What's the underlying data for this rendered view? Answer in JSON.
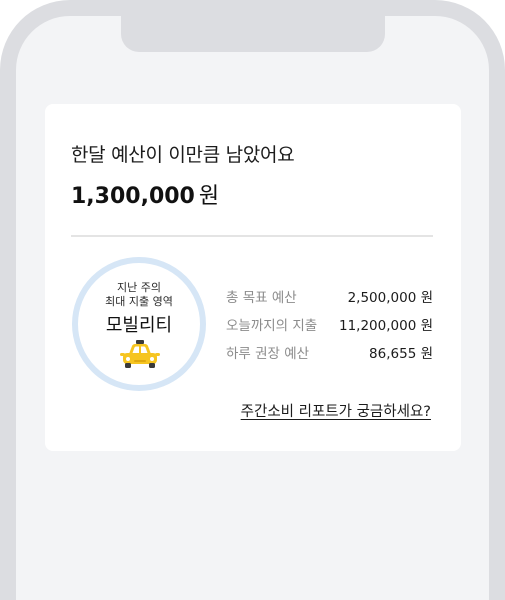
{
  "budget_card": {
    "headline": "한달 예산이 이만큼 남았어요",
    "remaining_amount": "1,300,000",
    "remaining_unit": "원",
    "top_category": {
      "caption_line1": "지난 주의",
      "caption_line2": "최대 지출 영역",
      "name": "모빌리티",
      "icon": "taxi-icon"
    },
    "stats": [
      {
        "label": "총 목표 예산",
        "value": "2,500,000 원"
      },
      {
        "label": "오늘까지의 지출",
        "value": "11,200,000 원"
      },
      {
        "label": "하루 권장 예산",
        "value": "86,655 원"
      }
    ],
    "report_link": "주간소비 리포트가 궁금하세요?"
  },
  "colors": {
    "frame": "#dcdde1",
    "screen_bg": "#f3f4f6",
    "ring": "#d6e6f6",
    "taxi_yellow": "#f6c521",
    "taxi_dark": "#3a3a3a"
  }
}
